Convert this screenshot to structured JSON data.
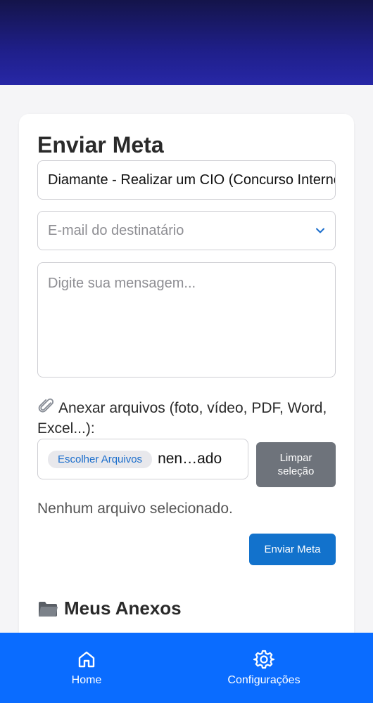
{
  "card": {
    "title": "Enviar Meta",
    "goal_value": "Diamante - Realizar um CIO (Concurso Interno de Oportunidades)",
    "email_placeholder": "E-mail do destinatário",
    "message_placeholder": "Digite sua mensagem...",
    "attach_label": "Anexar arquivos (foto, vídeo, PDF, Word, Excel...):",
    "choose_files_label": "Escolher Arquivos",
    "file_name_display": "nen…ado",
    "clear_selection_label": "Limpar seleção",
    "no_file_text": "Nenhum arquivo selecionado.",
    "send_label": "Enviar Meta",
    "attachments_title": "Meus Anexos"
  },
  "bottom_nav": {
    "items": [
      {
        "label": "Home",
        "icon": "home-icon"
      },
      {
        "label": "Configurações",
        "icon": "gear-icon"
      }
    ]
  },
  "colors": {
    "header_top": "#14144a",
    "header_bottom": "#2727a6",
    "nav_bg": "#0a6cff",
    "primary_button": "#1272cc",
    "secondary_button": "#6e737b"
  }
}
